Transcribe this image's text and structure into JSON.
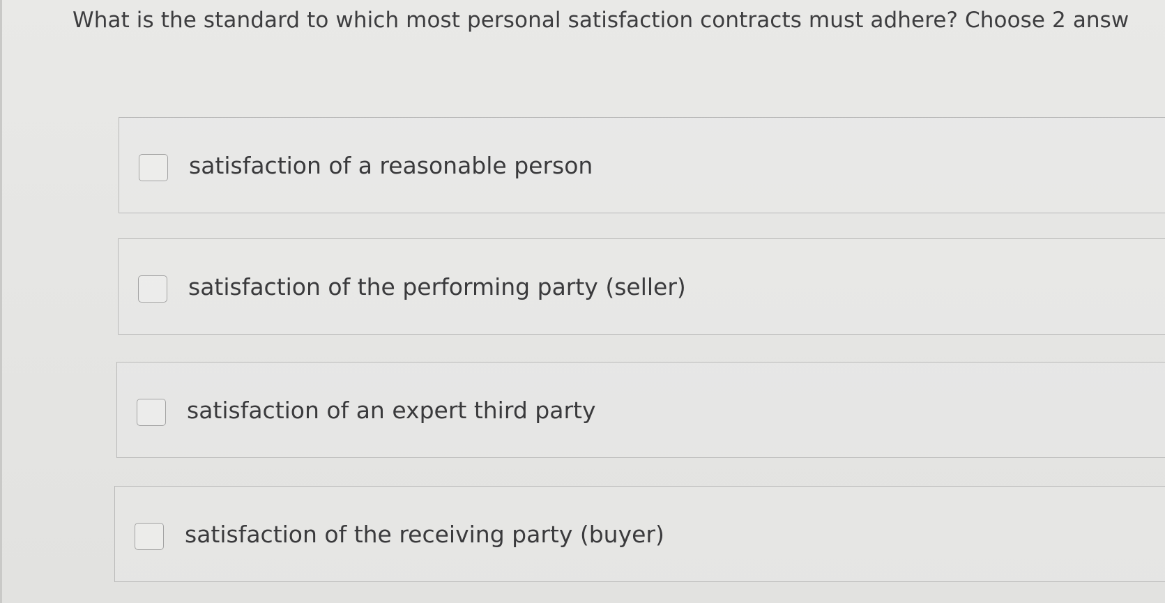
{
  "question": {
    "text": "What is the standard to which most personal satisfaction contracts must adhere? Choose 2 answ"
  },
  "options": [
    {
      "label": "satisfaction of a reasonable person",
      "checked": false
    },
    {
      "label": "satisfaction of the performing party (seller)",
      "checked": false
    },
    {
      "label": "satisfaction of an expert third party",
      "checked": false
    },
    {
      "label": "satisfaction of the receiving party (buyer)",
      "checked": false
    }
  ]
}
